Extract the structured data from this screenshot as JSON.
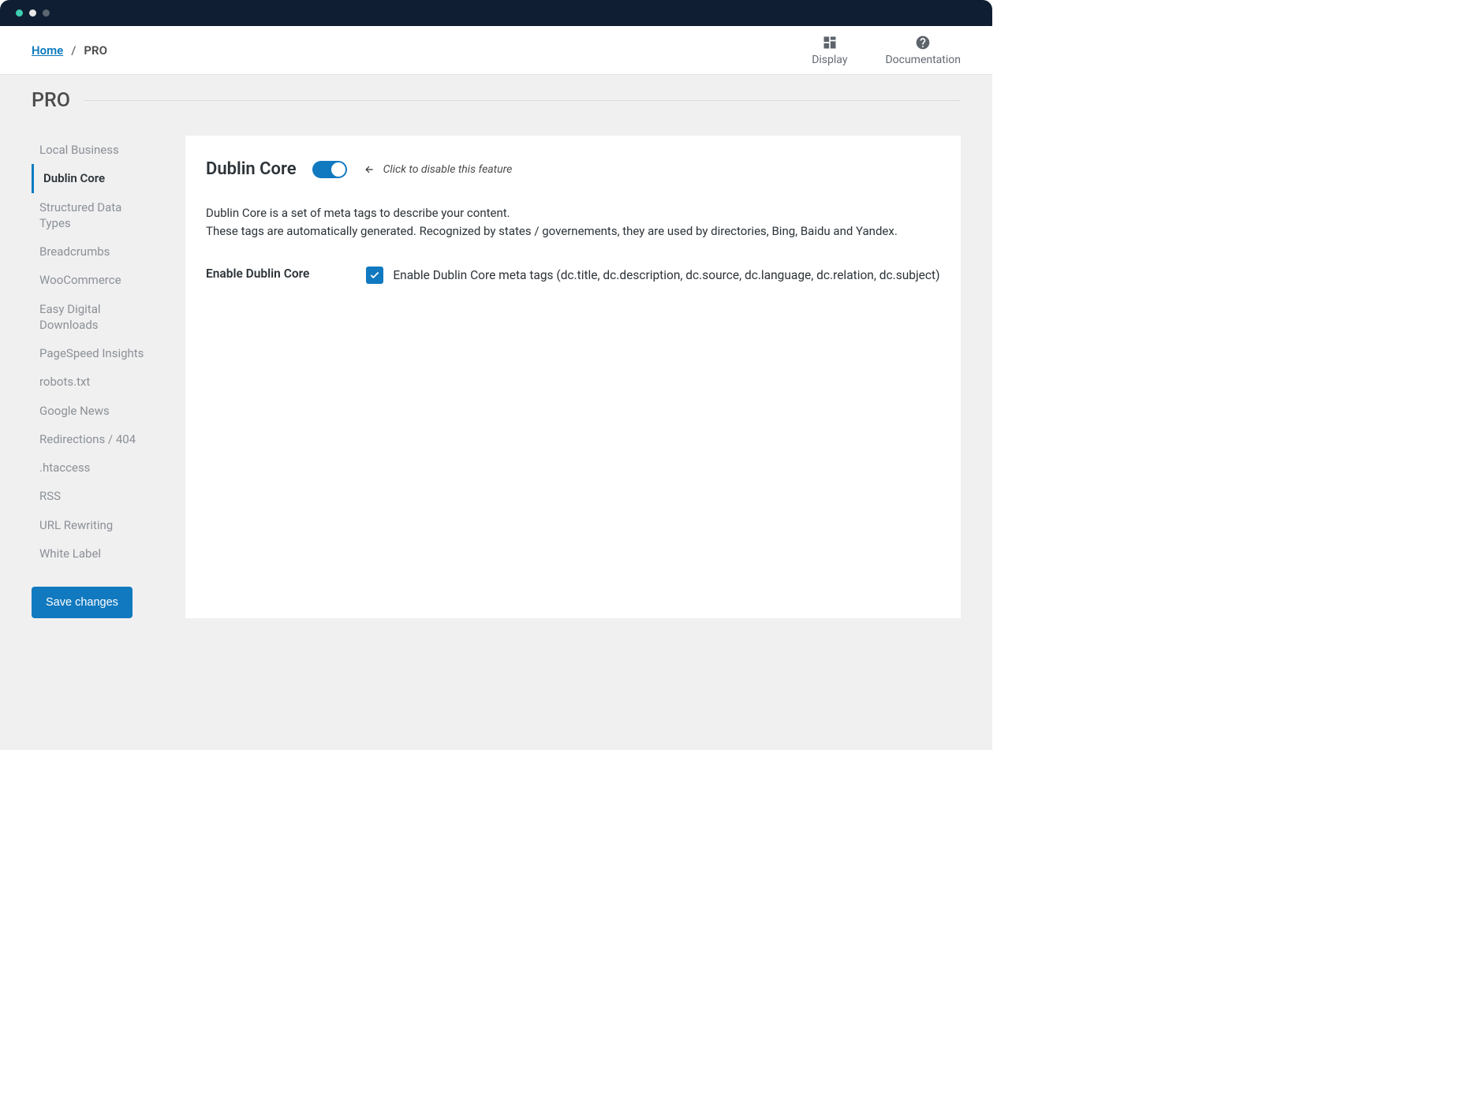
{
  "breadcrumb": {
    "home": "Home",
    "current": "PRO"
  },
  "toplinks": {
    "display": "Display",
    "documentation": "Documentation"
  },
  "page_title": "PRO",
  "sidebar": {
    "items": [
      {
        "label": "Local Business"
      },
      {
        "label": "Dublin Core"
      },
      {
        "label": "Structured Data Types"
      },
      {
        "label": "Breadcrumbs"
      },
      {
        "label": "WooCommerce"
      },
      {
        "label": "Easy Digital Downloads"
      },
      {
        "label": "PageSpeed Insights"
      },
      {
        "label": "robots.txt"
      },
      {
        "label": "Google News"
      },
      {
        "label": "Redirections / 404"
      },
      {
        "label": ".htaccess"
      },
      {
        "label": "RSS"
      },
      {
        "label": "URL Rewriting"
      },
      {
        "label": "White Label"
      }
    ],
    "active_index": 1
  },
  "save_button": "Save changes",
  "panel": {
    "title": "Dublin Core",
    "toggle_hint": "Click to disable this feature",
    "toggle_on": true,
    "desc_line1": "Dublin Core is a set of meta tags to describe your content.",
    "desc_line2": "These tags are automatically generated. Recognized by states / governements, they are used by directories, Bing, Baidu and Yandex.",
    "field_label": "Enable Dublin Core",
    "checkbox_checked": true,
    "checkbox_label": "Enable Dublin Core meta tags (dc.title, dc.description, dc.source, dc.language, dc.relation, dc.subject)"
  }
}
